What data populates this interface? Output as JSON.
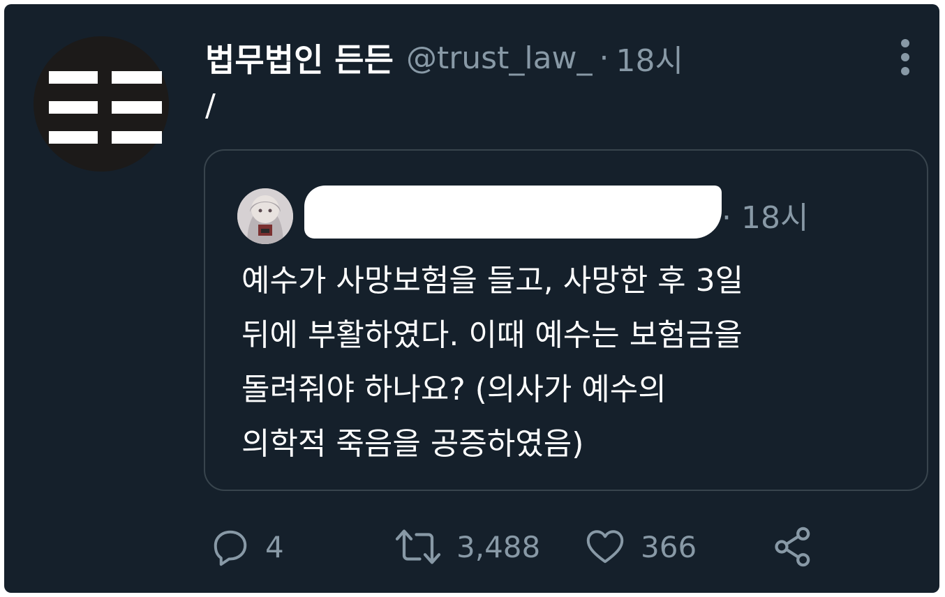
{
  "tweet": {
    "display_name": "법무법인 든든",
    "handle": "@trust_law_",
    "separator": "·",
    "time": "18시",
    "text": "/"
  },
  "quote": {
    "time": "· 18시",
    "text_lines": [
      "예수가 사망보험을 들고, 사망한 후 3일",
      "뒤에 부활하였다. 이때 예수는 보험금을",
      "돌려줘야 하나요? (의사가 예수의",
      "의학적 죽음을 공증하였음)"
    ]
  },
  "actions": {
    "reply_count": "4",
    "retweet_count": "3,488",
    "like_count": "366"
  },
  "icons": {
    "more": "vertical-ellipsis-icon",
    "reply": "reply-bubble-icon",
    "retweet": "retweet-icon",
    "like": "heart-icon",
    "share": "share-icon"
  },
  "colors": {
    "background": "#15202b",
    "text": "#ffffff",
    "muted": "#8899a6",
    "border": "#38444d"
  }
}
